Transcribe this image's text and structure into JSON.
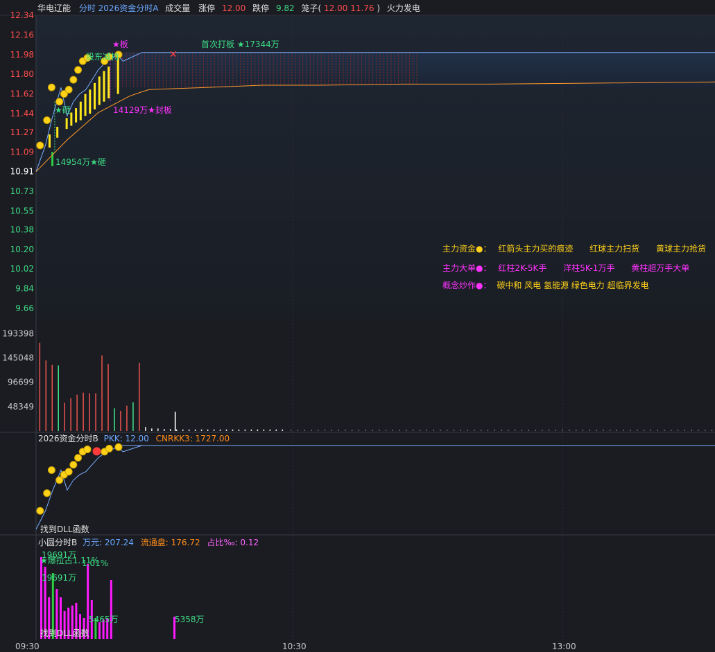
{
  "header": {
    "stock_name": "华电辽能",
    "indicator": "分时 2026资金分时A",
    "volume_label": "成交量",
    "limit_up_label": "涨停",
    "limit_up_value": "12.00",
    "limit_down_label": "跌停",
    "limit_down_value": "9.82",
    "cage_label": "笼子(",
    "cage_values": "12.00 11.76",
    "cage_close": ")",
    "concept": "火力发电"
  },
  "price_axis": {
    "ticks": [
      "12.34",
      "12.16",
      "11.98",
      "11.80",
      "11.62",
      "11.44",
      "11.27",
      "11.09",
      "10.91",
      "10.73",
      "10.55",
      "10.38",
      "10.20",
      "10.02",
      "9.84",
      "9.66"
    ],
    "prev_close": "10.91"
  },
  "volume_axis": {
    "ticks": [
      "193398",
      "145048",
      "96699",
      "48349"
    ]
  },
  "time_axis": {
    "ticks": [
      "09:30",
      "10:30",
      "13:00"
    ]
  },
  "annotations": {
    "board_star": "★板",
    "first_board": "首次打板 ★17344万",
    "shareholder": "股东减持",
    "seal_board": "14129万★封板",
    "smash_top": "★砸",
    "smash_bottom": "14954万★砸"
  },
  "legend": {
    "row1_title": "主力资金●：",
    "row1_items": [
      "红箭头主力买的痕迹",
      "红球主力扫货",
      "黄球主力抢货"
    ],
    "row2_title": "主力大单●：",
    "row2_items": [
      "红柱2K-5K手",
      "洋柱5K-1万手",
      "黄柱超万手大单"
    ],
    "row3_title": "概念炒作●：",
    "row3_text": "碳中和 风电 氢能源 绿色电力 超临界发电"
  },
  "panel_b": {
    "title": "2026资金分时B",
    "pkk_label": "PKK: 12.00",
    "cnrkk_label": "CNRKK3: 1727.00",
    "dll_text": "找到DLL函数"
  },
  "panel_c": {
    "title": "小圆分时B",
    "wan_label": "万元: 207.24",
    "float_label": "流通盘: 176.72",
    "ratio_label": "占比‰: 0.12",
    "ann1": "19691万",
    "ann2": "★爆拉占1.11%",
    "ann3": "1.01%",
    "ann4": "19691万",
    "ann5": "5465万",
    "ann6": "5358万",
    "dll_text": "找到DLL函数"
  },
  "chart_data": {
    "type": "line",
    "title": "华电辽能 分时",
    "y_ticks": [
      12.34,
      12.16,
      11.98,
      11.8,
      11.62,
      11.44,
      11.27,
      11.09,
      10.91,
      10.73,
      10.55,
      10.38,
      10.2,
      10.02,
      9.84,
      9.66
    ],
    "ylim": [
      9.66,
      12.34
    ],
    "x_ticks": [
      "09:30",
      "10:30",
      "13:00"
    ],
    "series": [
      {
        "name": "price",
        "x": [
          0,
          3,
          5,
          8,
          10,
          12,
          14,
          16,
          18,
          20,
          22,
          24,
          26,
          28,
          31,
          34,
          40,
          50,
          60,
          80,
          100,
          130,
          160,
          200,
          240
        ],
        "values": [
          10.91,
          11.15,
          11.38,
          11.68,
          11.42,
          11.55,
          11.62,
          11.66,
          11.75,
          11.84,
          11.9,
          11.94,
          11.98,
          11.92,
          11.96,
          12.0,
          12.0,
          12.0,
          12.0,
          12.0,
          12.0,
          12.0,
          12.0,
          12.0,
          12.0
        ]
      },
      {
        "name": "avg",
        "x": [
          0,
          10,
          20,
          30,
          34,
          40,
          60,
          80,
          100,
          130,
          160,
          200,
          240
        ],
        "values": [
          10.91,
          11.2,
          11.45,
          11.6,
          11.64,
          11.66,
          11.68,
          11.7,
          11.7,
          11.71,
          11.71,
          11.72,
          11.73
        ]
      }
    ],
    "volume_ticks": [
      193398,
      145048,
      96699,
      48349
    ],
    "volume": {
      "x": [
        1,
        3,
        5,
        7,
        9,
        11,
        13,
        15,
        17,
        19,
        21,
        23,
        25,
        27,
        29,
        31,
        33,
        35,
        37,
        39,
        41,
        43,
        45,
        47,
        49,
        51,
        53,
        55,
        57,
        59,
        61,
        63,
        65,
        67,
        69,
        71,
        73,
        75,
        77,
        79
      ],
      "values": [
        175000,
        140000,
        131000,
        130000,
        56000,
        65000,
        72000,
        76000,
        75000,
        75000,
        150000,
        133000,
        45000,
        40000,
        50000,
        57000,
        135000,
        8000,
        5000,
        5000,
        4000,
        4000,
        3000,
        3000,
        3000,
        3000,
        3000,
        3000,
        3000,
        3000,
        3000,
        3000,
        3000,
        3000,
        3000,
        3000,
        3000,
        3000,
        3000,
        3000
      ]
    }
  }
}
